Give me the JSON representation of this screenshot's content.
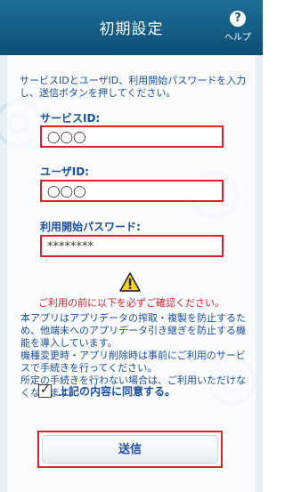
{
  "header": {
    "title": "初期設定",
    "help_label": "ヘルプ",
    "help_icon": "question-icon"
  },
  "intro": "サービスIDとユーザID、利用開始パスワードを入力し、送信ボタンを押してください。",
  "fields": {
    "service_id": {
      "label": "サービスID:",
      "value": "◯◯◯"
    },
    "user_id": {
      "label": "ユーザID:",
      "value": "◯◯◯"
    },
    "password": {
      "label": "利用開始パスワード:",
      "value": "********"
    }
  },
  "warning": {
    "icon": "warning-icon",
    "text": "ご利用の前に以下を必ずご確認ください。"
  },
  "notice": {
    "p1": "本アプリはアプリデータの搾取・複製を防止するため、他端末へのアプリデータ引き継ぎを防止する機能を導入しています。",
    "p2": "機種変更時・アプリ削除時は事前にご利用のサービスで手続きを行ってください。",
    "p3": "所定の手続きを行わない場合は、ご利用いただけなくなります。"
  },
  "agree": {
    "label": "上記の内容に同意する。",
    "checked": true
  },
  "send_button": "送信",
  "colors": {
    "header": "#14587e",
    "accent_text": "#1d4fa0",
    "highlight_border": "#e0212c"
  }
}
